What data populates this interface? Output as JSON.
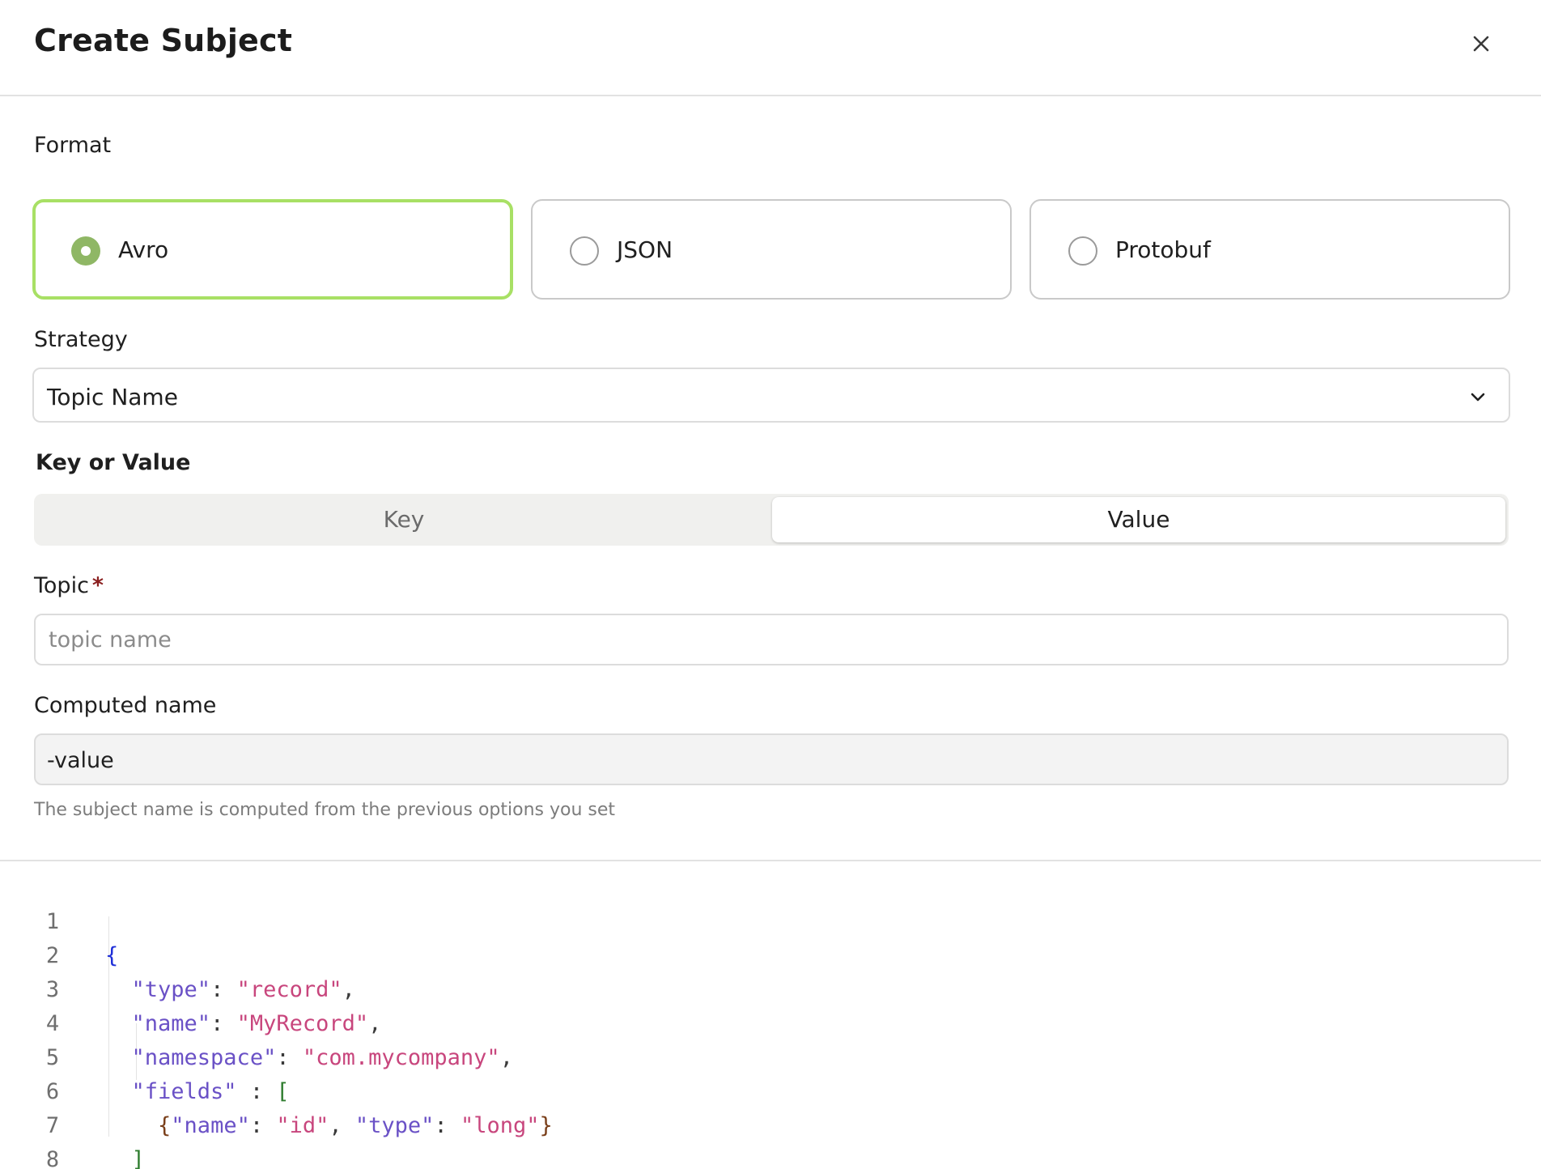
{
  "dialog": {
    "title": "Create Subject",
    "close_icon": "close-icon"
  },
  "format": {
    "label": "Format",
    "options": [
      {
        "label": "Avro",
        "selected": true
      },
      {
        "label": "JSON",
        "selected": false
      },
      {
        "label": "Protobuf",
        "selected": false
      }
    ]
  },
  "strategy": {
    "label": "Strategy",
    "selected": "Topic Name",
    "icon": "chevron-down-icon"
  },
  "key_or_value": {
    "label": "Key or Value",
    "options": [
      "Key",
      "Value"
    ],
    "selected": "Value"
  },
  "topic": {
    "label": "Topic",
    "required_mark": "*",
    "value": "",
    "placeholder": "topic name"
  },
  "computed_name": {
    "label": "Computed name",
    "value": "-value",
    "help": "The subject name is computed from the previous options you set"
  },
  "editor": {
    "line_numbers": [
      "1",
      "2",
      "3",
      "4",
      "5",
      "6",
      "7",
      "8"
    ],
    "schema": {
      "type_key": "\"type\"",
      "type_value": "\"record\"",
      "name_key": "\"name\"",
      "name_value": "\"MyRecord\"",
      "namespace_key": "\"namespace\"",
      "namespace_value": "\"com.mycompany\"",
      "fields_key": "\"fields\"",
      "field_name_key": "\"name\"",
      "field_name_value": "\"id\"",
      "field_type_key": "\"type\"",
      "field_type_value": "\"long\""
    }
  },
  "colors": {
    "selected_border": "#a8e065",
    "radio_selected": "#8fb765",
    "json_key": "#6a51c6",
    "json_string": "#c8467d",
    "required": "#8a1f1f"
  }
}
